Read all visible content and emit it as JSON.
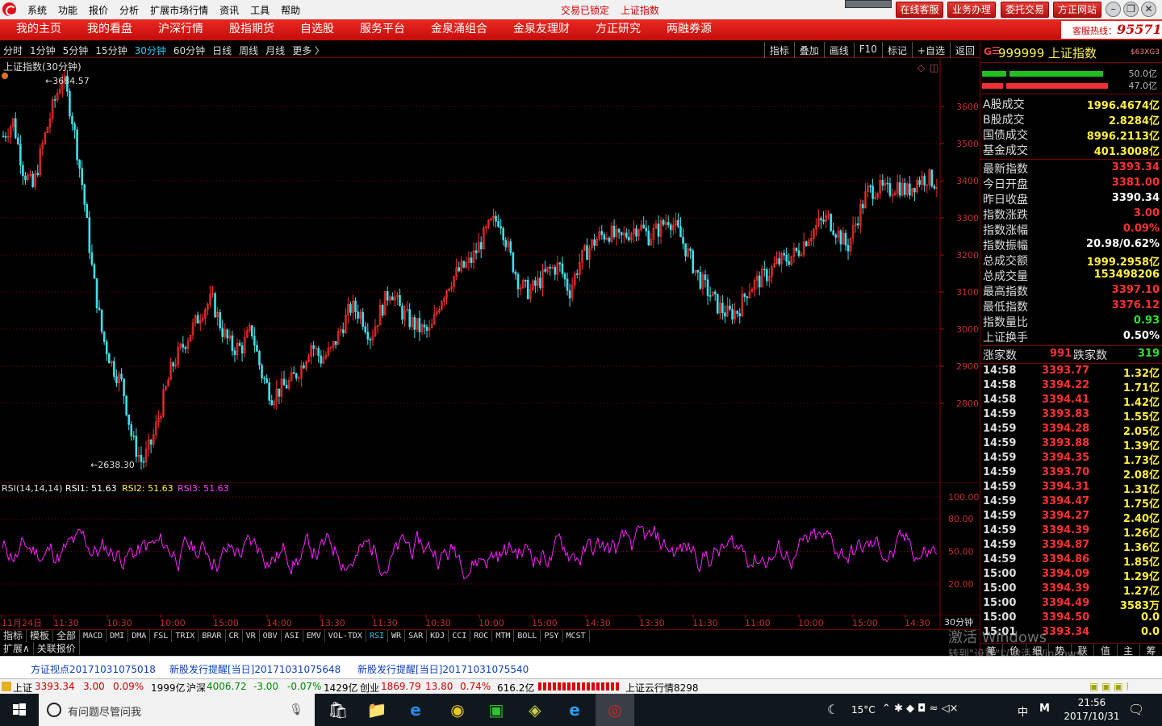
{
  "menubar": {
    "items": [
      "系统",
      "功能",
      "报价",
      "分析",
      "扩展市场行情",
      "资讯",
      "工具",
      "帮助"
    ],
    "status": [
      "交易已锁定",
      "上证指数"
    ],
    "buttons": [
      "在线客服",
      "业务办理",
      "委托交易",
      "方正网站"
    ],
    "window_controls": [
      "–",
      "❐",
      "✕"
    ]
  },
  "navbar": {
    "items": [
      "我的主页",
      "我的看盘",
      "沪深行情",
      "股指期货",
      "自选股",
      "服务平台",
      "金泉涌组合",
      "金泉友理财",
      "方正研究",
      "两融券源"
    ],
    "hotline_label": "客服热线：",
    "hotline_number": "95571"
  },
  "periodbar": {
    "periods": [
      "分时",
      "1分钟",
      "5分钟",
      "15分钟",
      "30分钟",
      "60分钟",
      "日线",
      "周线",
      "月线",
      "更多 〉"
    ],
    "active": "30分钟",
    "tools": [
      "指标",
      "叠加",
      "画线",
      "F10",
      "标记",
      "+自选",
      "返回"
    ]
  },
  "chart": {
    "title": "上证指数(30分钟)",
    "high_label": "←3684.57",
    "low_label": "←2638.30",
    "y_ticks": [
      "3600",
      "3500",
      "3400",
      "3300",
      "3200",
      "3100",
      "3000",
      "2900",
      "2800"
    ],
    "rsi_label": "RSI(14,14,14)",
    "rsi1": "RSI1: 51.63",
    "rsi2": "RSI2: 51.63",
    "rsi3": "RSI3: 51.63",
    "rsi_ticks": [
      "100.00",
      "80.00",
      "50.00",
      "20.00"
    ],
    "time_ticks": [
      "11月24日",
      "11:30",
      "10:30",
      "10:00",
      "15:00",
      "14:00",
      "13:30",
      "11:30",
      "10:30",
      "10:00",
      "15:00",
      "14:30",
      "13:30",
      "11:30",
      "11:00",
      "10:00",
      "15:00",
      "14:30"
    ],
    "period_label": "30分钟"
  },
  "chart_data": {
    "type": "candlestick",
    "title": "上证指数(30分钟)",
    "ylim": [
      2600,
      3700
    ],
    "y_ticks": [
      3600,
      3500,
      3400,
      3300,
      3200,
      3100,
      3000,
      2900,
      2800
    ],
    "high": 3684.57,
    "low": 2638.3,
    "close_path": [
      3520,
      3560,
      3430,
      3380,
      3500,
      3600,
      3684,
      3560,
      3380,
      3150,
      2980,
      2900,
      2850,
      2700,
      2638,
      2700,
      2800,
      2900,
      2950,
      3000,
      3050,
      3080,
      3000,
      2950,
      2950,
      3000,
      2880,
      2820,
      2840,
      2860,
      2900,
      2960,
      2920,
      2940,
      3000,
      3060,
      3040,
      2980,
      3050,
      3110,
      3050,
      3020,
      3000,
      2990,
      3080,
      3130,
      3160,
      3180,
      3230,
      3280,
      3300,
      3200,
      3120,
      3100,
      3130,
      3160,
      3170,
      3100,
      3180,
      3220,
      3250,
      3260,
      3240,
      3260,
      3280,
      3250,
      3270,
      3300,
      3260,
      3200,
      3140,
      3100,
      3060,
      3040,
      3050,
      3110,
      3130,
      3150,
      3180,
      3190,
      3210,
      3250,
      3280,
      3300,
      3260,
      3220,
      3300,
      3370,
      3380,
      3370,
      3390,
      3370,
      3400,
      3410,
      3393
    ],
    "rsi": {
      "label": "RSI(14,14,14)",
      "values": {
        "RSI1": 51.63,
        "RSI2": 51.63,
        "RSI3": 51.63
      },
      "ylim": [
        0,
        100
      ],
      "ticks": [
        100,
        80,
        50,
        20
      ]
    }
  },
  "indicators": {
    "tabs": [
      "指标",
      "模板",
      "全部",
      "MACD",
      "DMI",
      "DMA",
      "FSL",
      "TRIX",
      "BRAR",
      "CR",
      "VR",
      "OBV",
      "ASI",
      "EMV",
      "VOL-TDX",
      "RSI",
      "WR",
      "SAR",
      "KDJ",
      "CCI",
      "ROC",
      "MTM",
      "BOLL",
      "PSY",
      "MCST"
    ],
    "active": "RSI",
    "ext": [
      "扩展∧",
      "关联报价"
    ]
  },
  "rightpanel": {
    "g": "G",
    "menu": "☰",
    "code": "999999 上证指数",
    "sub": "$63XG3",
    "pct1": "50.0亿",
    "pct2": "47.0亿",
    "turnover": [
      {
        "k": "A股成交",
        "v": "1996.4674亿"
      },
      {
        "k": "B股成交",
        "v": "2.8284亿"
      },
      {
        "k": "国债成交",
        "v": "8996.2113亿"
      },
      {
        "k": "基金成交",
        "v": "401.3008亿"
      }
    ],
    "stats": [
      {
        "k": "最新指数",
        "v": "3393.34",
        "c": "red"
      },
      {
        "k": "今日开盘",
        "v": "3381.00",
        "c": "red"
      },
      {
        "k": "昨日收盘",
        "v": "3390.34",
        "c": "white"
      },
      {
        "k": "指数涨跌",
        "v": "3.00",
        "c": "red"
      },
      {
        "k": "指数涨幅",
        "v": "0.09%",
        "c": "red"
      },
      {
        "k": "指数振幅",
        "v": "20.98/0.62%",
        "c": "white"
      },
      {
        "k": "总成交额",
        "v": "1999.2958亿",
        "c": "yellow"
      },
      {
        "k": "总成交量",
        "v": "153498206",
        "c": "yellow"
      },
      {
        "k": "最高指数",
        "v": "3397.10",
        "c": "red"
      },
      {
        "k": "最低指数",
        "v": "3376.12",
        "c": "red"
      },
      {
        "k": "指数量比",
        "v": "0.93",
        "c": "green"
      },
      {
        "k": "上证换手",
        "v": "0.50%",
        "c": "white"
      }
    ],
    "advance_label": "涨家数",
    "advance": "991",
    "decline_label": "跌家数",
    "decline": "319",
    "ticks": [
      [
        "14:58",
        "3393.77",
        "1.32亿"
      ],
      [
        "14:58",
        "3394.22",
        "1.71亿"
      ],
      [
        "14:58",
        "3394.41",
        "1.42亿"
      ],
      [
        "14:59",
        "3393.83",
        "1.55亿"
      ],
      [
        "14:59",
        "3394.28",
        "2.05亿"
      ],
      [
        "14:59",
        "3393.88",
        "1.39亿"
      ],
      [
        "14:59",
        "3394.35",
        "1.73亿"
      ],
      [
        "14:59",
        "3393.70",
        "2.08亿"
      ],
      [
        "14:59",
        "3394.31",
        "1.31亿"
      ],
      [
        "14:59",
        "3394.47",
        "1.75亿"
      ],
      [
        "14:59",
        "3394.27",
        "2.40亿"
      ],
      [
        "14:59",
        "3394.39",
        "1.26亿"
      ],
      [
        "14:59",
        "3394.87",
        "1.36亿"
      ],
      [
        "14:59",
        "3394.86",
        "1.85亿"
      ],
      [
        "15:00",
        "3394.09",
        "1.29亿"
      ],
      [
        "15:00",
        "3394.39",
        "1.27亿"
      ],
      [
        "15:00",
        "3394.49",
        "3583万"
      ],
      [
        "15:00",
        "3394.50",
        "0.0"
      ],
      [
        "15:01",
        "3393.34",
        "0.0"
      ]
    ],
    "bottom_tabs": [
      "笔",
      "价",
      "细",
      "势",
      "联",
      "值",
      "主",
      "筹"
    ]
  },
  "watermark": {
    "line1": "激活 Windows",
    "line2": "转到\"设置\"以激活 Windows。"
  },
  "news": [
    "方证视点20171031075018",
    "新股发行提醒[当日]20171031075648",
    "新股发行提醒[当日]20171031075540"
  ],
  "quotebar": {
    "sh_label": "上证",
    "sh": "3393.34",
    "sh_chg": "3.00",
    "sh_pct": "0.09%",
    "sh_amt": "1999亿",
    "sz_label": "沪深",
    "sz": "4006.72",
    "sz_chg": "-3.00",
    "sz_pct": "-0.07%",
    "sz_amt": "1429亿",
    "cy_label": "创业",
    "cy": "1869.79",
    "cy_chg": "13.80",
    "cy_pct": "0.74%",
    "cy_amt": "616.2亿",
    "cloud": "上证云行情8298"
  },
  "taskbar": {
    "search_placeholder": "有问题尽管问我",
    "temp": "15°C",
    "ime": "中",
    "time": "21:56",
    "date": "2017/10/31"
  }
}
